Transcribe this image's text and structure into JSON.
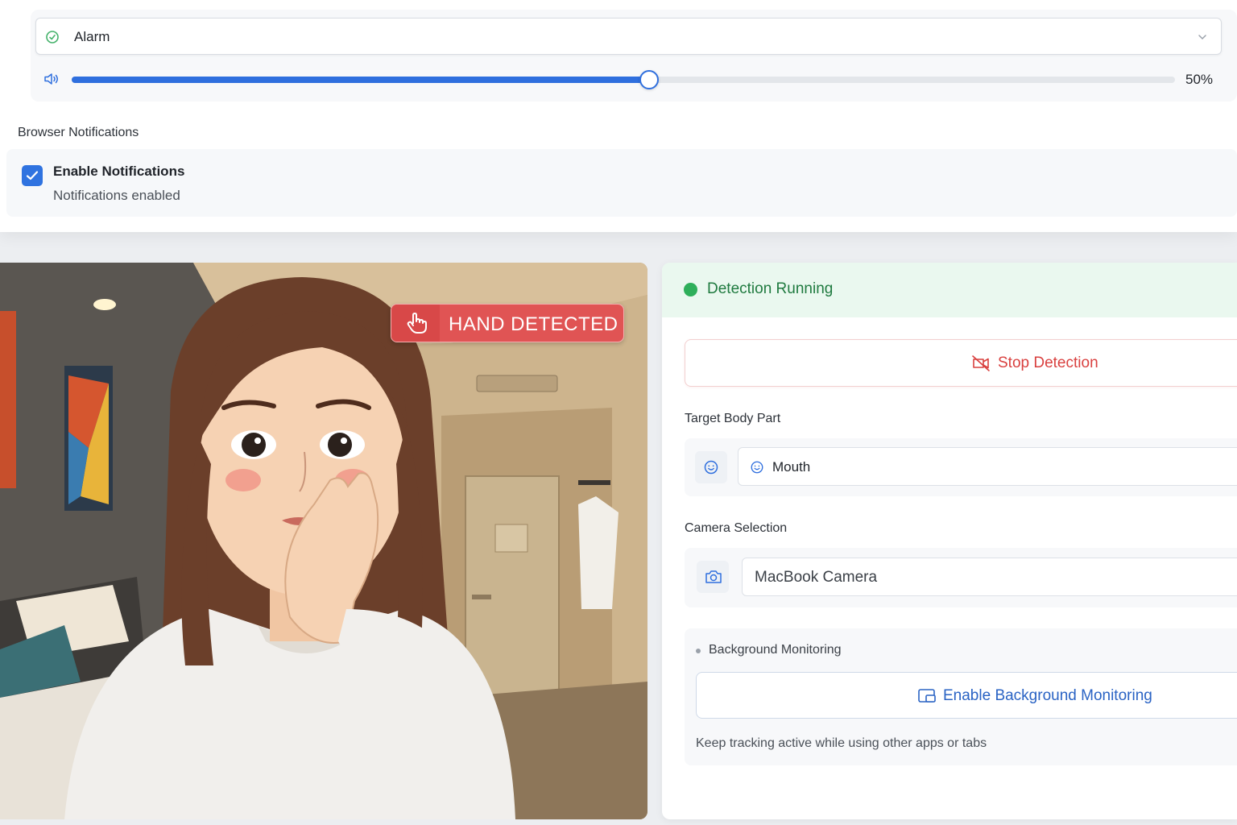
{
  "sound": {
    "selected": "Alarm",
    "volume_value": 0.5,
    "volume_label": "50%",
    "accent_color": "#2f6fde"
  },
  "notifications": {
    "heading": "Browser Notifications",
    "checkbox_checked": true,
    "title": "Enable Notifications",
    "status": "Notifications enabled"
  },
  "camera": {
    "badge_text": "HAND DETECTED",
    "badge_color": "#e05454",
    "badge_icon": "hand-pointer-icon"
  },
  "detection": {
    "status_text": "Detection Running",
    "status_color": "#2eaf5a",
    "stop_label": "Stop Detection",
    "stop_icon": "camera-off-icon",
    "target_heading": "Target Body Part",
    "target_value": "Mouth",
    "target_icon": "smile-icon",
    "camera_heading": "Camera Selection",
    "camera_value": "MacBook Camera",
    "camera_icon": "camera-icon"
  },
  "background": {
    "heading": "Background Monitoring",
    "button_label": "Enable Background Monitoring",
    "button_icon": "picture-in-picture-icon",
    "hint": "Keep tracking active while using other apps or tabs"
  }
}
